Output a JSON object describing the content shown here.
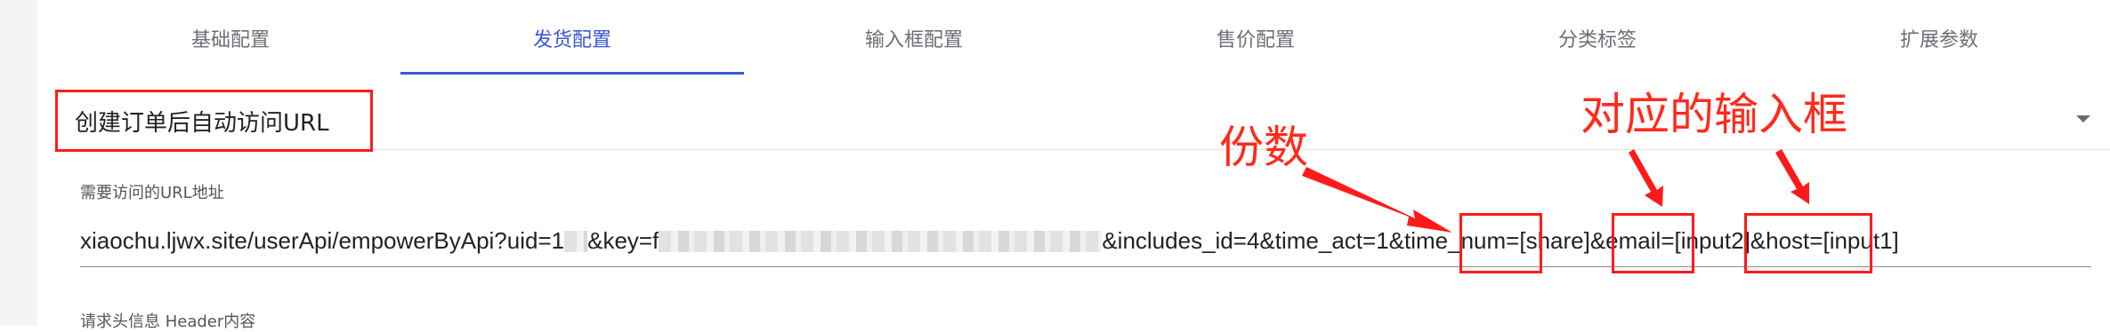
{
  "tabs": [
    {
      "label": "基础配置",
      "active": false
    },
    {
      "label": "发货配置",
      "active": true
    },
    {
      "label": "输入框配置",
      "active": false
    },
    {
      "label": "售价配置",
      "active": false
    },
    {
      "label": "分类标签",
      "active": false
    },
    {
      "label": "扩展参数",
      "active": false
    }
  ],
  "delivery": {
    "selected_option": "创建订单后自动访问URL",
    "url_label": "需要访问的URL地址",
    "url_value": {
      "prefix": "xiaochu.ljwx.site/userApi/empowerByApi?uid=1",
      "after_uid": "&key=f",
      "middle": "&includes_id=4&time_act=1&time_num=",
      "share": "[share]",
      "email_part": "&email=",
      "input2": "[input2]",
      "host_part": "&host=",
      "input1": "[input1]"
    },
    "header_label": "请求头信息 Header内容"
  },
  "annotations": {
    "quantity": "份数",
    "corresponding_input": "对应的输入框"
  },
  "colors": {
    "accent": "#3b55d6",
    "annotation_red": "#ff1a1a"
  }
}
